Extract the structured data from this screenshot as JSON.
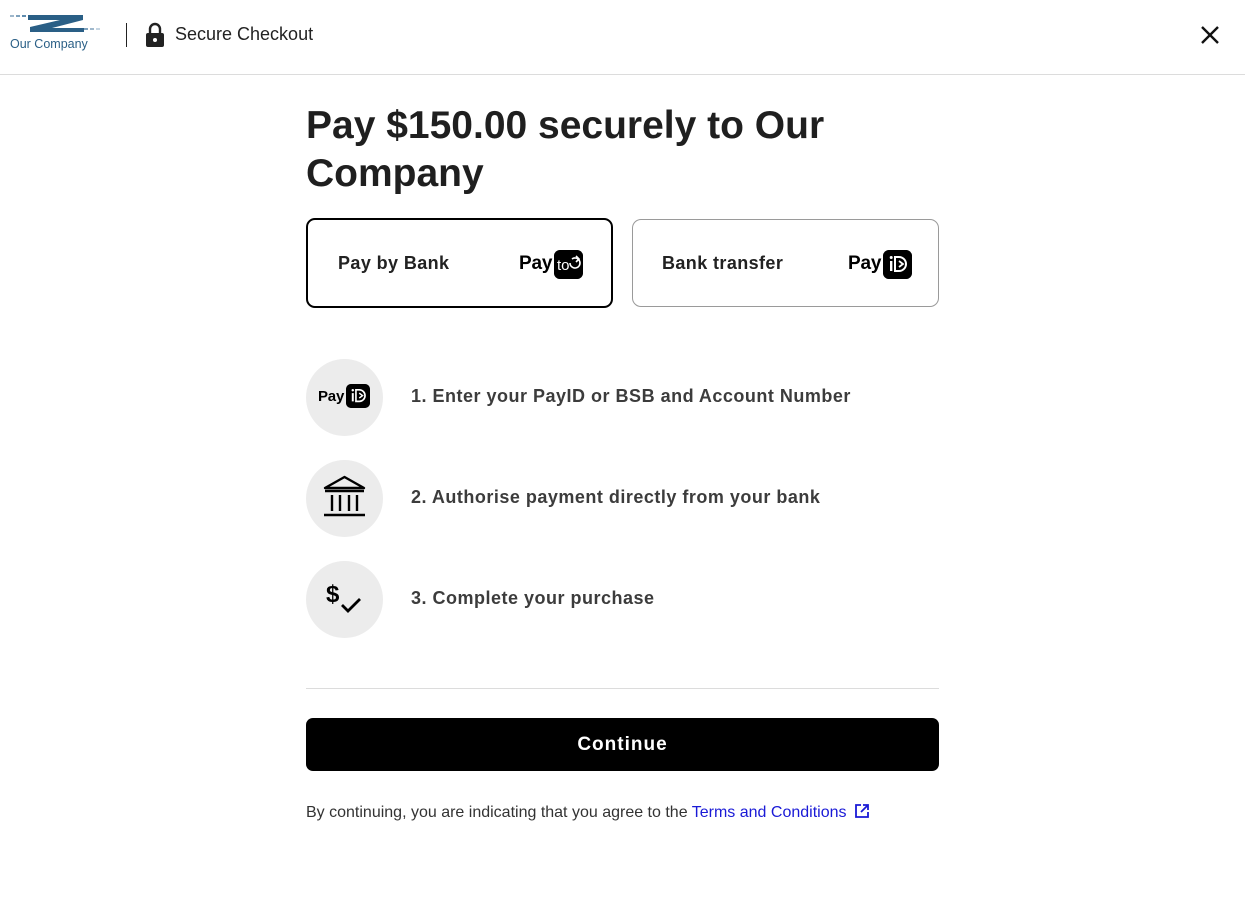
{
  "header": {
    "logo_text": "Our Company",
    "title": "Secure Checkout",
    "close_icon": "close-icon",
    "lock_icon": "lock-icon"
  },
  "main": {
    "title": "Pay $150.00 securely to Our Company"
  },
  "payment_methods": [
    {
      "label": "Pay by Bank",
      "badge_text": "Pay",
      "badge_icon": "payto-icon",
      "selected": true
    },
    {
      "label": "Bank transfer",
      "badge_text": "Pay",
      "badge_icon": "payid-icon",
      "selected": false
    }
  ],
  "steps": [
    {
      "text": "1. Enter your PayID or BSB and Account Number",
      "icon": "payid-icon",
      "badge_text": "Pay"
    },
    {
      "text": "2. Authorise payment directly from your bank",
      "icon": "bank-icon"
    },
    {
      "text": "3. Complete your purchase",
      "icon": "dollar-check-icon"
    }
  ],
  "continue_label": "Continue",
  "terms": {
    "prefix": "By continuing, you are indicating that you agree to the",
    "link_text": "Terms and Conditions",
    "link_icon": "external-link-icon"
  },
  "colors": {
    "brand_blue": "#2a5f86",
    "link": "#1a1ad6",
    "button": "#000000",
    "step_circle": "#ececec"
  }
}
